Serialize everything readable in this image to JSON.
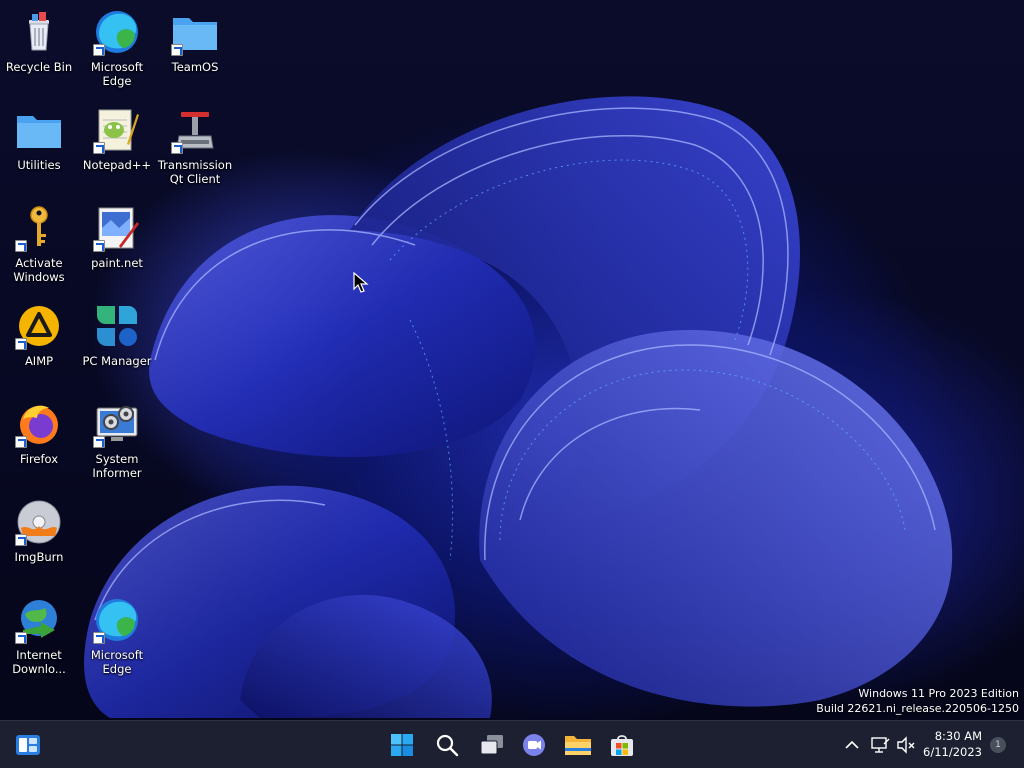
{
  "desktop": {
    "icons": [
      {
        "label": "Recycle Bin",
        "icon": "recycle-bin-icon"
      },
      {
        "label": "Microsoft\nEdge",
        "icon": "edge-icon"
      },
      {
        "label": "TeamOS",
        "icon": "folder-icon"
      },
      {
        "label": "Utilities",
        "icon": "folder-icon"
      },
      {
        "label": "Notepad++",
        "icon": "notepadpp-icon"
      },
      {
        "label": "Transmission\nQt Client",
        "icon": "transmission-icon"
      },
      {
        "label": "Activate\nWindows",
        "icon": "key-icon"
      },
      {
        "label": "paint.net",
        "icon": "paintnet-icon"
      },
      {
        "label": "AIMP",
        "icon": "aimp-icon"
      },
      {
        "label": "PC Manager",
        "icon": "pc-manager-icon"
      },
      {
        "label": "Firefox",
        "icon": "firefox-icon"
      },
      {
        "label": "System\nInformer",
        "icon": "system-informer-icon"
      },
      {
        "label": "ImgBurn",
        "icon": "imgburn-icon"
      },
      {
        "label": "Internet\nDownlo...",
        "icon": "idm-icon"
      },
      {
        "label": "Microsoft\nEdge",
        "icon": "edge-icon"
      }
    ]
  },
  "watermark": {
    "line1": "Windows 11 Pro 2023 Edition",
    "line2": "Build 22621.ni_release.220506-1250"
  },
  "taskbar": {
    "pinned": [
      "widgets-icon",
      "start-icon",
      "search-icon",
      "task-view-icon",
      "chat-icon",
      "file-explorer-icon",
      "store-icon"
    ],
    "tray": {
      "time": "8:30 AM",
      "date": "6/11/2023",
      "notification_count": "1"
    }
  },
  "colors": {
    "taskbar_bg": "#1c2030",
    "accent": "#3a8ee6",
    "wallpaper_primary": "#1f2aa8"
  }
}
